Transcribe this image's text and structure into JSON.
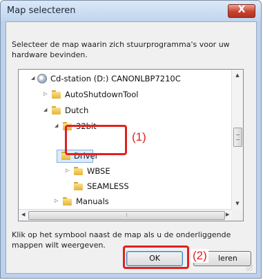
{
  "dialog": {
    "title": "Map selecteren",
    "close_label": "X",
    "description": "Selecteer de map waarin zich stuurprogramma's voor uw hardware bevinden.",
    "hint": "Klik op het symbool naast de map als u de onderliggende mappen wilt weergeven.",
    "ok_label": "OK",
    "cancel_label": "leren"
  },
  "tree": {
    "root": "Cd-station (D:) CANONLBP7210C",
    "items": [
      {
        "label": "AutoShutdownTool",
        "expanded": false
      },
      {
        "label": "Dutch",
        "expanded": true
      },
      {
        "label": "32bit",
        "expanded": true
      },
      {
        "label": "Driver",
        "selected": true
      },
      {
        "label": "WBSE",
        "expanded": false
      },
      {
        "label": "SEAMLESS"
      },
      {
        "label": "Manuals",
        "expanded": false
      }
    ]
  },
  "callouts": {
    "step1": "(1)",
    "step2": "(2)"
  },
  "colors": {
    "highlight": "#e02020",
    "selection": "#dcebfc",
    "title_bar": "#bfd5ee"
  }
}
